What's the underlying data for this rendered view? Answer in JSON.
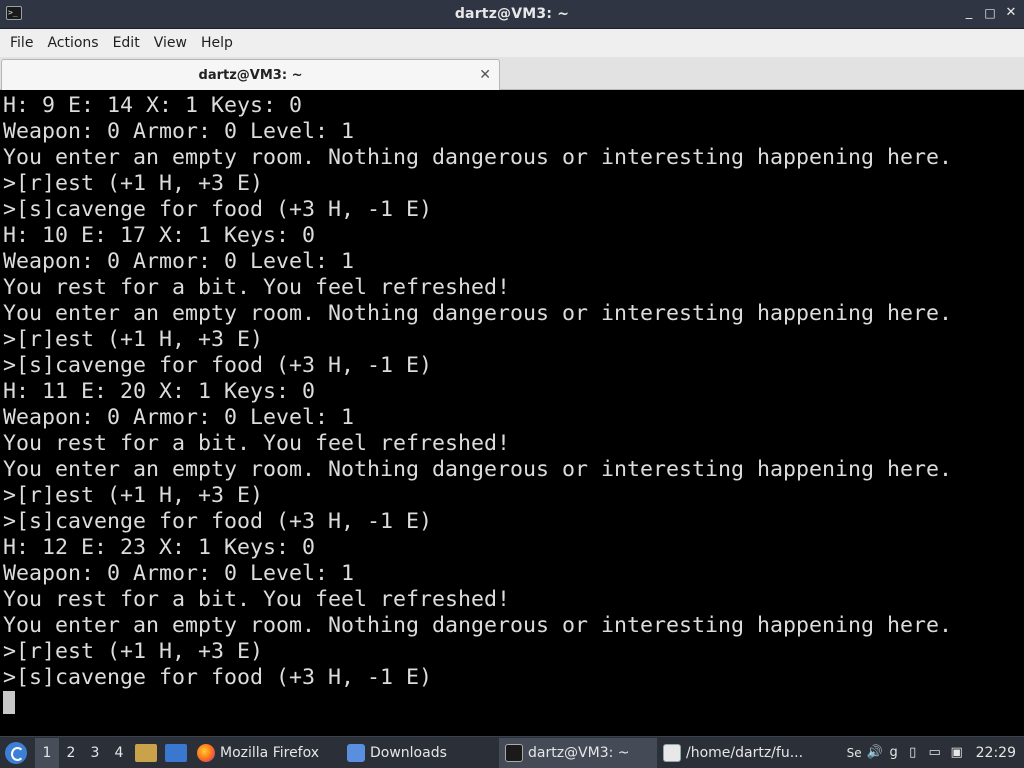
{
  "window": {
    "title": "dartz@VM3: ~",
    "app_icon_text": ">_",
    "controls": {
      "minimize": "_",
      "maximize": "□",
      "close": "✕"
    }
  },
  "menubar": {
    "items": [
      "File",
      "Actions",
      "Edit",
      "View",
      "Help"
    ]
  },
  "tab": {
    "label": "dartz@VM3: ~",
    "close": "✕"
  },
  "terminal": {
    "lines": [
      "H: 9 E: 14 X: 1 Keys: 0",
      "Weapon: 0 Armor: 0 Level: 1",
      "You enter an empty room. Nothing dangerous or interesting happening here.",
      ">[r]est (+1 H, +3 E)",
      ">[s]cavenge for food (+3 H, -1 E)",
      "H: 10 E: 17 X: 1 Keys: 0",
      "Weapon: 0 Armor: 0 Level: 1",
      "You rest for a bit. You feel refreshed!",
      "You enter an empty room. Nothing dangerous or interesting happening here.",
      ">[r]est (+1 H, +3 E)",
      ">[s]cavenge for food (+3 H, -1 E)",
      "H: 11 E: 20 X: 1 Keys: 0",
      "Weapon: 0 Armor: 0 Level: 1",
      "You rest for a bit. You feel refreshed!",
      "You enter an empty room. Nothing dangerous or interesting happening here.",
      ">[r]est (+1 H, +3 E)",
      ">[s]cavenge for food (+3 H, -1 E)",
      "H: 12 E: 23 X: 1 Keys: 0",
      "Weapon: 0 Armor: 0 Level: 1",
      "You rest for a bit. You feel refreshed!",
      "You enter an empty room. Nothing dangerous or interesting happening here.",
      ">[r]est (+1 H, +3 E)",
      ">[s]cavenge for food (+3 H, -1 E)"
    ]
  },
  "taskbar": {
    "workspaces": [
      "1",
      "2",
      "3",
      "4"
    ],
    "active_workspace": "1",
    "tasks": [
      {
        "label": "Mozilla Firefox",
        "icon": "firefox-icon"
      },
      {
        "label": "Downloads",
        "icon": "folder-icon"
      },
      {
        "label": "dartz@VM3: ~",
        "icon": "terminal-icon"
      },
      {
        "label": "/home/dartz/fu...",
        "icon": "editor-icon"
      }
    ],
    "tray_text": [
      "Se",
      "g"
    ],
    "clock": "22:29"
  },
  "colors": {
    "titlebar": "#2f3542",
    "terminal_bg": "#000000",
    "terminal_fg": "#dcdcdc",
    "taskbar": "#2b3038"
  }
}
